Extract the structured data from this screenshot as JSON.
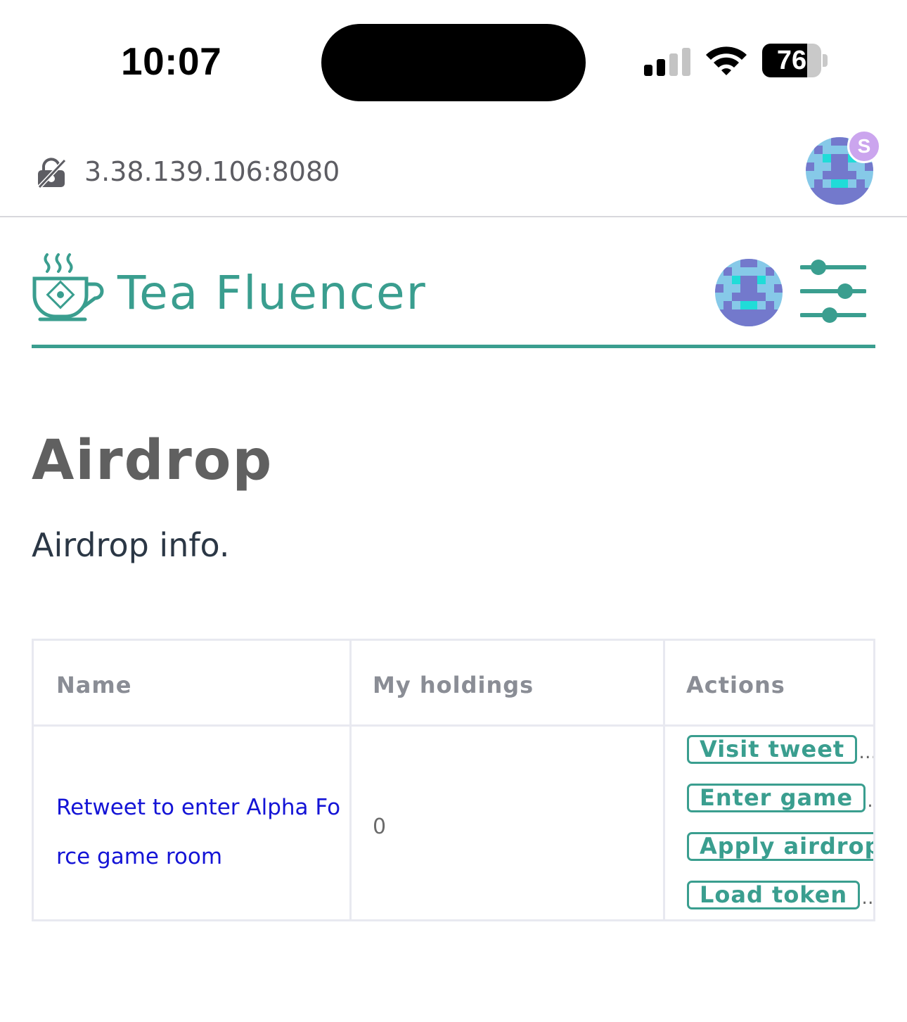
{
  "status_bar": {
    "time": "10:07",
    "battery_level": "76",
    "signal_bars_active": 2,
    "signal_bars_total": 4,
    "icons": [
      "cellular-signal-icon",
      "wifi-icon",
      "battery-icon"
    ]
  },
  "browser": {
    "url": "3.38.139.106:8080",
    "security_icon": "not-secure-lock-icon",
    "profile_badge": "S",
    "profile_badge_color": "#cba5ee"
  },
  "header": {
    "brand": "Tea Fluencer",
    "logo_icon": "tea-cup-icon",
    "menu_icon": "sliders-icon",
    "accent_color": "#3a9e8f"
  },
  "page": {
    "title": "Airdrop",
    "subtitle": "Airdrop info."
  },
  "table": {
    "headers": [
      "Name",
      "My holdings",
      "Actions"
    ],
    "rows": [
      {
        "name": "Retweet to enter Alpha Force game room",
        "holdings": "0",
        "actions": [
          "Visit tweet",
          "Enter game",
          "Apply airdrop",
          "Load token"
        ],
        "overflow": "…"
      }
    ]
  },
  "colors": {
    "link": "#1414d6",
    "title": "#606060",
    "subtitle": "#2b3745",
    "table_border": "#e8e9f0",
    "header_text": "#8a8d95"
  }
}
